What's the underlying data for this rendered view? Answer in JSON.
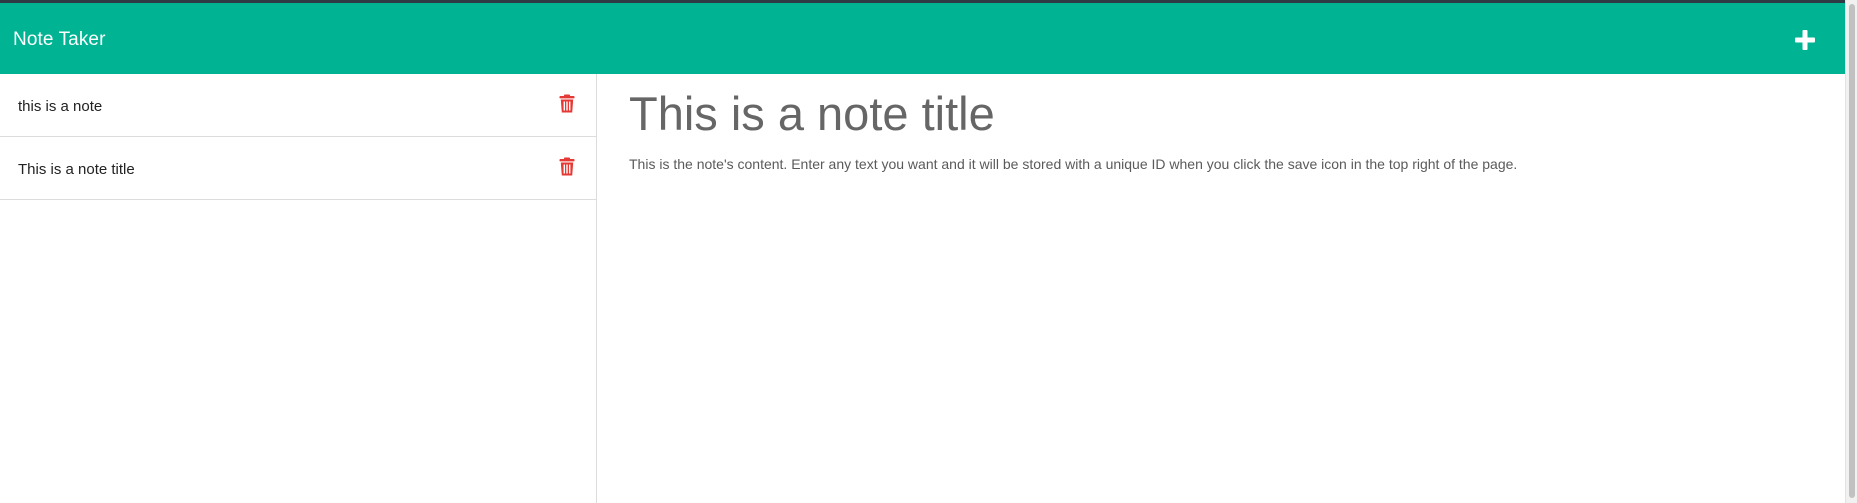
{
  "header": {
    "brand": "Note Taker",
    "new_note_icon": "plus-icon",
    "color": "#00b493"
  },
  "notes": [
    {
      "title": "this is a note",
      "delete_icon": "trash-icon"
    },
    {
      "title": "This is a note title",
      "delete_icon": "trash-icon"
    }
  ],
  "editor": {
    "title": "This is a note title",
    "text": "This is the note's content.  Enter any text you want and it will be stored with a unique ID when you click the save icon in the top right of the page."
  },
  "colors": {
    "accent": "#00b493",
    "delete": "#e53935",
    "text_muted": "#666666"
  }
}
